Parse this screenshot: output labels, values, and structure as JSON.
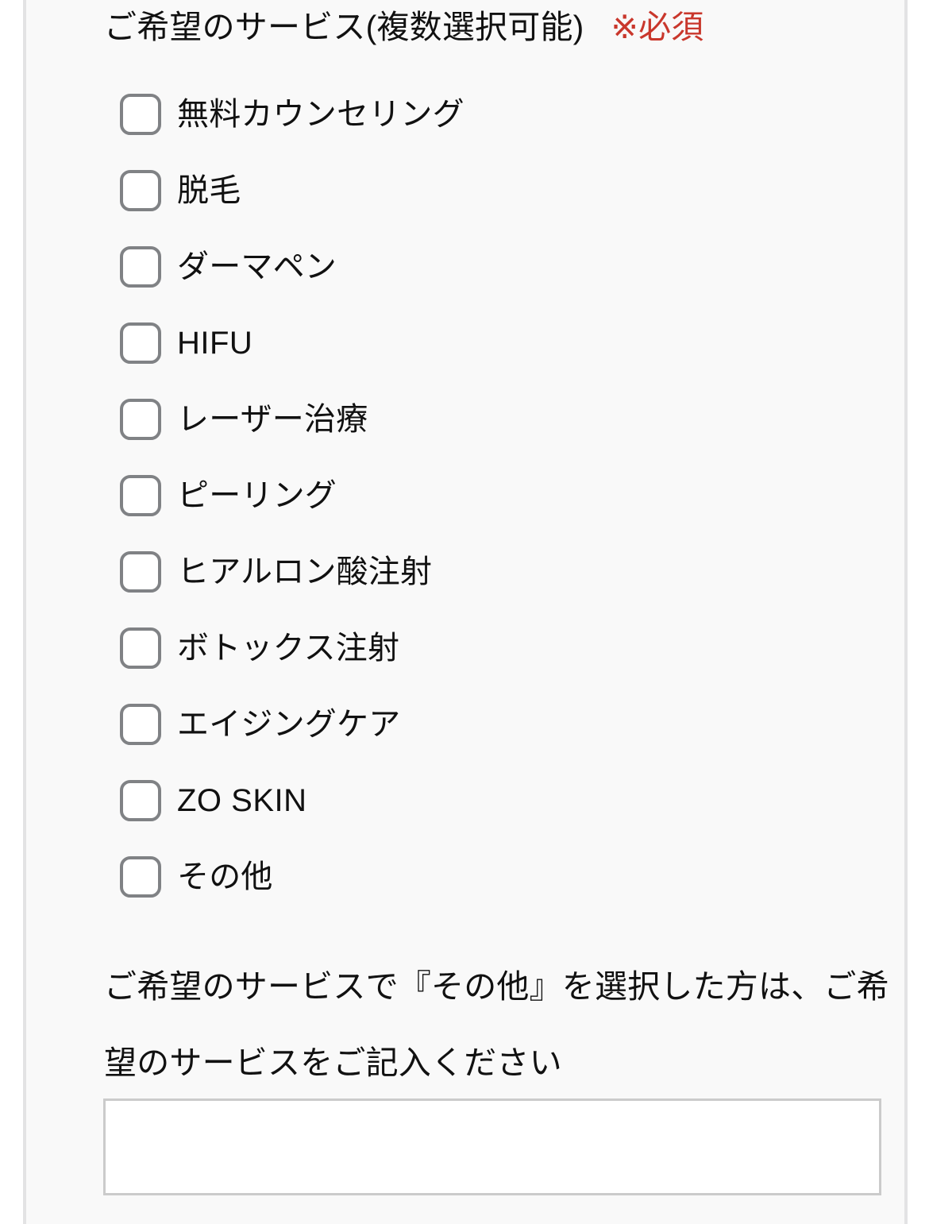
{
  "form": {
    "service_question": {
      "label": "ご希望のサービス(複数選択可能)",
      "required_mark": "※必須",
      "required_color": "#c9372c",
      "options": [
        {
          "label": "無料カウンセリング",
          "checked": false
        },
        {
          "label": "脱毛",
          "checked": false
        },
        {
          "label": "ダーマペン",
          "checked": false
        },
        {
          "label": "HIFU",
          "checked": false
        },
        {
          "label": "レーザー治療",
          "checked": false
        },
        {
          "label": "ピーリング",
          "checked": false
        },
        {
          "label": "ヒアルロン酸注射",
          "checked": false
        },
        {
          "label": "ボトックス注射",
          "checked": false
        },
        {
          "label": "エイジングケア",
          "checked": false
        },
        {
          "label": "ZO SKIN",
          "checked": false
        },
        {
          "label": "その他",
          "checked": false
        }
      ]
    },
    "other_service_question": {
      "label": "ご希望のサービスで『その他』を選択した方は、ご希望のサービスをご記入ください",
      "value": "",
      "placeholder": ""
    }
  },
  "scrollbar": {
    "name": "vertical-scrollbar",
    "thumb_color": "#7c7c7c"
  },
  "theme": {
    "page_background": "#ffffff",
    "panel_background": "#f9f9f9",
    "text_color": "#111111",
    "checkbox_border": "#808285",
    "input_border": "#cbcbcb"
  }
}
